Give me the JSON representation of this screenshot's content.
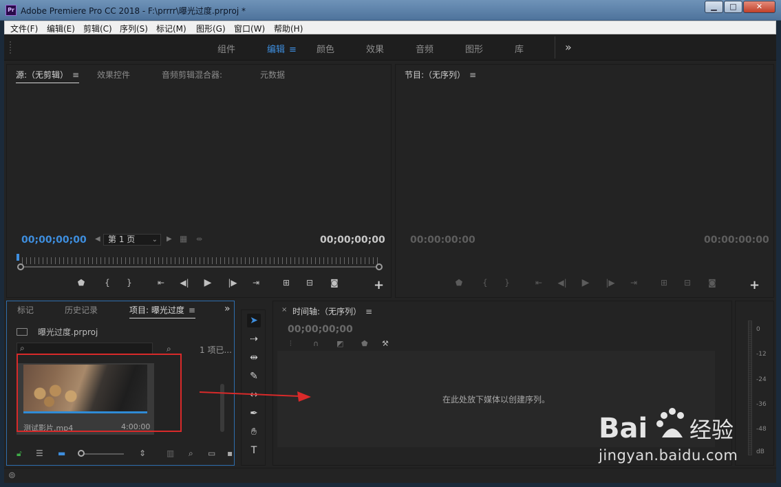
{
  "window": {
    "title": "Adobe Premiere Pro CC 2018 - F:\\prrrr\\曝光过度.prproj *",
    "app_icon": "Pr",
    "min": "▁",
    "max": "□",
    "close": "✕"
  },
  "menu": [
    "文件(F)",
    "编辑(E)",
    "剪辑(C)",
    "序列(S)",
    "标记(M)",
    "图形(G)",
    "窗口(W)",
    "帮助(H)"
  ],
  "workspaces": {
    "tabs": [
      "组件",
      "编辑",
      "颜色",
      "效果",
      "音频",
      "图形",
      "库"
    ],
    "active": "编辑",
    "more": "»"
  },
  "source_panel": {
    "tabs": [
      "源:（无剪辑）",
      "效果控件",
      "音频剪辑混合器:",
      "元数据"
    ],
    "timecode_in": "00;00;00;00",
    "timecode_out": "00;00;00;00",
    "page": "第 1 页"
  },
  "program_panel": {
    "tab": "节目:（无序列）",
    "timecode_in": "00:00:00:00",
    "timecode_out": "00:00:00:00"
  },
  "project_panel": {
    "tabs": [
      "标记",
      "历史记录",
      "项目: 曝光过度"
    ],
    "file": "曝光过度.prproj",
    "count": "1 项已...",
    "clip": {
      "name": "测试影片.mp4",
      "duration": "4:00:00"
    }
  },
  "timeline_panel": {
    "tab": "时间轴:（无序列）",
    "timecode": "00;00;00;00",
    "drop_message": "在此处放下媒体以创建序列。"
  },
  "audio_meter": {
    "labels": [
      "0",
      "-12",
      "-24",
      "-36",
      "-48",
      "dB"
    ]
  },
  "watermark": {
    "brand": "Bai 经验",
    "url": "jingyan.baidu.com"
  },
  "colors": {
    "accent": "#3e8ede",
    "annotation": "#d92a2a"
  }
}
